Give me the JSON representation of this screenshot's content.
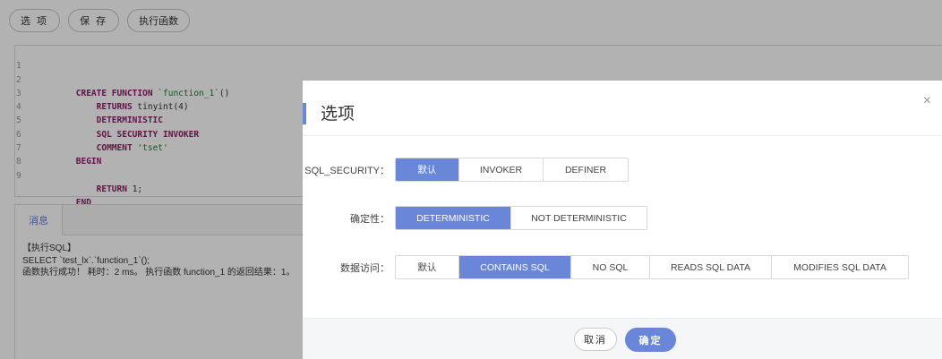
{
  "toolbar": {
    "options_label": "选 项",
    "save_label": "保 存",
    "execute_label": "执行函数"
  },
  "editor": {
    "lines": [
      {
        "n": "1",
        "tokens": [
          {
            "t": "CREATE FUNCTION ",
            "c": "kw"
          },
          {
            "t": "`function_1`",
            "c": "str"
          },
          {
            "t": "()",
            "c": "plain"
          }
        ]
      },
      {
        "n": "2",
        "tokens": [
          {
            "t": "    RETURNS ",
            "c": "kw"
          },
          {
            "t": "tinyint(",
            "c": "plain"
          },
          {
            "t": "4",
            "c": "num"
          },
          {
            "t": ")",
            "c": "plain"
          }
        ]
      },
      {
        "n": "3",
        "tokens": [
          {
            "t": "    DETERMINISTIC",
            "c": "kw"
          }
        ]
      },
      {
        "n": "4",
        "tokens": [
          {
            "t": "    SQL SECURITY INVOKER",
            "c": "kw"
          }
        ]
      },
      {
        "n": "5",
        "tokens": [
          {
            "t": "    COMMENT ",
            "c": "kw"
          },
          {
            "t": "'tset'",
            "c": "str"
          }
        ]
      },
      {
        "n": "6",
        "tokens": [
          {
            "t": "BEGIN",
            "c": "kw"
          }
        ]
      },
      {
        "n": "7",
        "tokens": []
      },
      {
        "n": "8",
        "tokens": [
          {
            "t": "    RETURN ",
            "c": "kw"
          },
          {
            "t": "1;",
            "c": "plain"
          }
        ]
      },
      {
        "n": "9",
        "tokens": [
          {
            "t": "END",
            "c": "kw"
          }
        ]
      }
    ]
  },
  "messages": {
    "tab_label": "消息",
    "lines": [
      "【执行SQL】",
      "SELECT `test_lx`.`function_1`();",
      "函数执行成功！ 耗时：2 ms。 执行函数 function_1 的返回结果：1。"
    ]
  },
  "modal": {
    "title": "选项",
    "close": "×",
    "rows": [
      {
        "label": "SQL_SECURITY：",
        "options": [
          {
            "label": "默认",
            "active": true
          },
          {
            "label": "INVOKER",
            "active": false
          },
          {
            "label": "DEFINER",
            "active": false
          }
        ]
      },
      {
        "label": "确定性：",
        "options": [
          {
            "label": "DETERMINISTIC",
            "active": true
          },
          {
            "label": "NOT DETERMINISTIC",
            "active": false
          }
        ]
      },
      {
        "label": "数据访问：",
        "options": [
          {
            "label": "默认",
            "active": false
          },
          {
            "label": "CONTAINS SQL",
            "active": true
          },
          {
            "label": "NO SQL",
            "active": false
          },
          {
            "label": "READS SQL DATA",
            "active": false
          },
          {
            "label": "MODIFIES SQL DATA",
            "active": false
          }
        ]
      }
    ],
    "cancel_label": "取消",
    "ok_label": "确定"
  },
  "colors": {
    "accent": "#6a86d8",
    "keyword": "#8f1c6a",
    "string": "#1a7f37"
  }
}
